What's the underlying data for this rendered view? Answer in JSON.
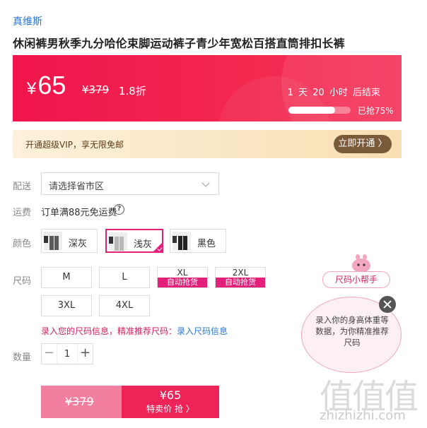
{
  "brand": "真维斯",
  "product_title": "休闲裤男秋季九分哈伦束脚运动裤子青少年宽松百搭直筒排扣长裤",
  "price_banner": {
    "currency": "¥",
    "price": "65",
    "original_price": "¥379",
    "discount": "1.8折",
    "countdown": "1 天 20 小时 后结束",
    "sold_percent": 75,
    "sold_text": "已抢75%",
    "accent_color": "#f0154d"
  },
  "vip": {
    "text": "开通超级VIP，享无限免邮",
    "button_label": "立即开通 〉"
  },
  "delivery": {
    "label": "配送",
    "select_value": "请选择省市区"
  },
  "shipping": {
    "label": "运费",
    "text": "订单满88元免运费",
    "help_icon": "?"
  },
  "color": {
    "label": "颜色",
    "options": [
      {
        "name": "深灰",
        "swatch": "#5a5a5a",
        "selected": false
      },
      {
        "name": "浅灰",
        "swatch": "#b8b8b8",
        "selected": true
      },
      {
        "name": "黑色",
        "swatch": "#222222",
        "selected": false
      }
    ]
  },
  "size": {
    "label": "尺码",
    "options": [
      {
        "name": "M",
        "badge": ""
      },
      {
        "name": "L",
        "badge": ""
      },
      {
        "name": "XL",
        "badge": "自动抢货"
      },
      {
        "name": "2XL",
        "badge": "自动抢货"
      },
      {
        "name": "3XL",
        "badge": ""
      },
      {
        "name": "4XL",
        "badge": ""
      }
    ],
    "hint_text": "录入您的尺码信息，精准推荐尺码：",
    "hint_link": "录入尺码信息"
  },
  "quantity": {
    "label": "数量",
    "minus": "−",
    "value": "1",
    "plus": "+"
  },
  "buy": {
    "original_price": "¥379",
    "price": "¥65",
    "action": "特卖价 抢 〉"
  },
  "size_helper": {
    "label": "尺码小帮手",
    "bubble_text": "录入你的身高体重等数据，为你精准推荐尺码"
  },
  "watermark": {
    "glyphs": "值值值",
    "domain": "zhizhizhi.com"
  }
}
